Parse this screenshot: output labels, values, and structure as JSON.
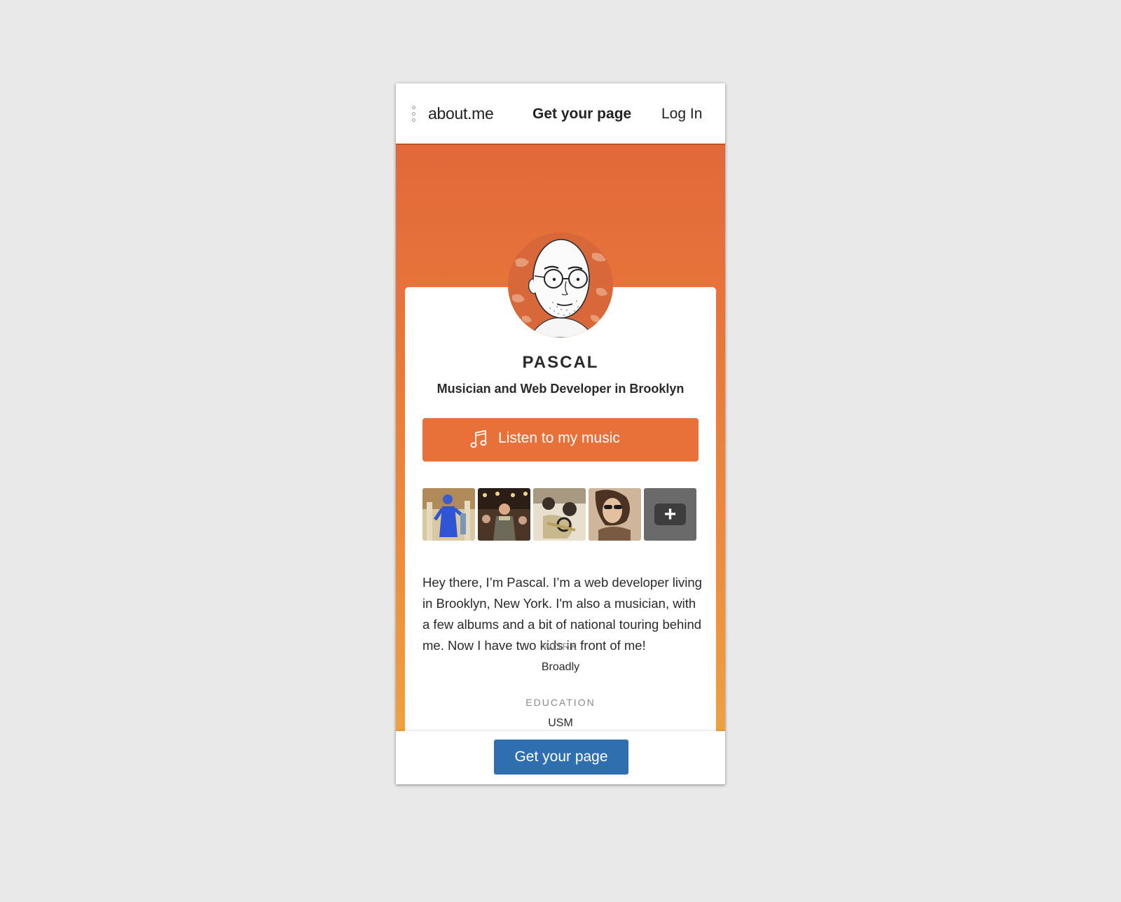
{
  "nav": {
    "logo": "about.me",
    "get_page": "Get your page",
    "login": "Log In"
  },
  "profile": {
    "name": "PASCAL",
    "tagline": "Musician and Web Developer in Brooklyn",
    "button_label": "Listen to my music",
    "bio": "Hey there, I’m Pascal. I’m a web developer living in Brooklyn, New York. I'm also a musician, with a few albums and a bit of national touring behind me. Now I have two kids in front of me!",
    "work_label": "WORK",
    "work_value": "Broadly",
    "education_label": "EDUCATION",
    "education_value": "USM"
  },
  "gallery": {
    "more_icon": "+"
  },
  "footer": {
    "cta": "Get your page"
  },
  "colors": {
    "page_bg": "#e9e9e9",
    "accent": "#e8713a",
    "cta_blue": "#2f6fb0"
  }
}
